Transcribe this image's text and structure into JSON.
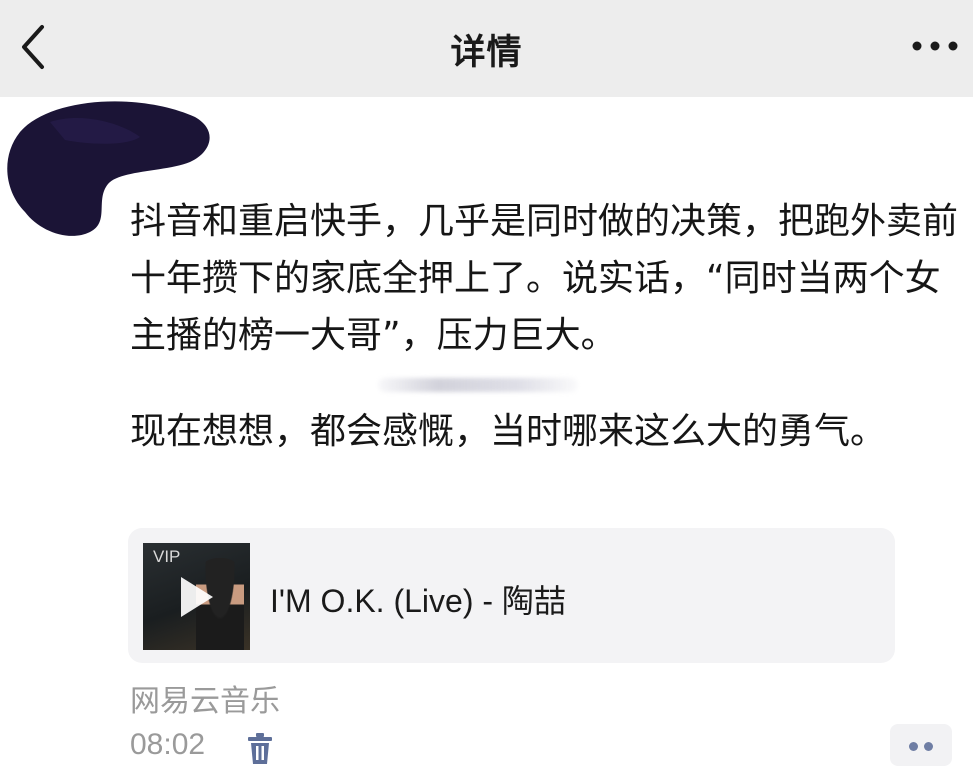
{
  "navbar": {
    "title": "详情",
    "back_icon": "chevron-left-icon",
    "more_icon": "more-horizontal-icon"
  },
  "post": {
    "paragraphs": [
      "抖音和重启快手，几乎是同时做的决策，把跑外卖前十年攒下的家底全押上了。说实话，“同时当两个女主播的榜一大哥”，压力巨大。",
      "现在想想，都会感慨，当时哪来这么大的勇气。"
    ]
  },
  "music_card": {
    "badge": "VIP",
    "title": "I'M O.K. (Live) - 陶喆",
    "play_icon": "play-icon"
  },
  "footer": {
    "source": "网易云音乐",
    "time": "08:02",
    "delete_icon": "trash-icon",
    "action_icon": "two-dots-icon"
  },
  "colors": {
    "navbar_bg": "#ededed",
    "meta_text": "#9a9a9a",
    "card_bg": "#f3f3f5",
    "action_dots": "#6f7ea4"
  }
}
